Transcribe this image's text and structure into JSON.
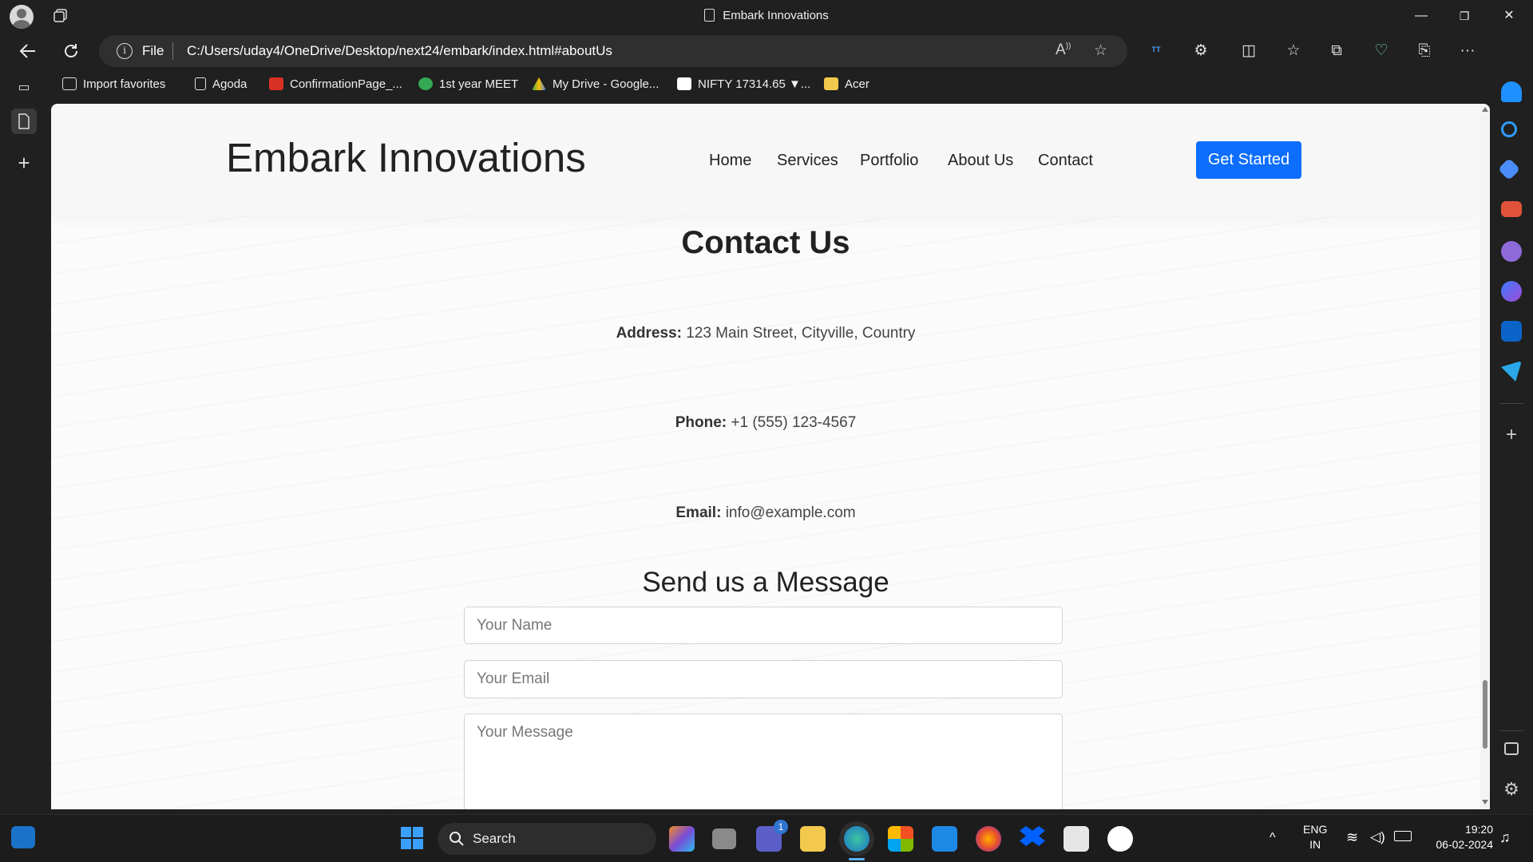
{
  "window": {
    "title": "Embark Innovations",
    "controls": {
      "minimize": "—",
      "maximize": "❐",
      "close": "✕"
    }
  },
  "addressbar": {
    "scheme_label": "File",
    "url": "C:/Users/uday4/OneDrive/Desktop/next24/embark/index.html#aboutUs"
  },
  "favorites": [
    {
      "label": "Import favorites",
      "icon": "import-icon",
      "color": "#dddddd"
    },
    {
      "label": "Agoda",
      "icon": "page-icon",
      "color": "#dddddd"
    },
    {
      "label": "ConfirmationPage_...",
      "icon": "pdf-icon",
      "color": "#d93025"
    },
    {
      "label": "1st year MEET",
      "icon": "meet-icon",
      "color": "#34a853"
    },
    {
      "label": "My Drive - Google...",
      "icon": "drive-icon",
      "color": "#fbbc04"
    },
    {
      "label": "NIFTY 17314.65 ▼...",
      "icon": "tradingview-icon",
      "color": "#ffffff"
    },
    {
      "label": "Acer",
      "icon": "folder-icon",
      "color": "#f2c94c"
    }
  ],
  "site": {
    "brand": "Embark Innovations",
    "nav": [
      "Home",
      "Services",
      "Portfolio",
      "About Us",
      "Contact"
    ],
    "cta": "Get Started",
    "contact_heading": "Contact Us",
    "address_label": "Address:",
    "address_value": "123 Main Street, Cityville, Country",
    "phone_label": "Phone:",
    "phone_value": "+1 (555) 123-4567",
    "email_label": "Email:",
    "email_value": "info@example.com",
    "form_heading": "Send us a Message",
    "name_placeholder": "Your Name",
    "email_placeholder": "Your Email",
    "message_placeholder": "Your Message",
    "accent": "#0d6efd"
  },
  "taskbar": {
    "search_label": "Search",
    "teams_badge": "1",
    "lang_top": "ENG",
    "lang_bottom": "IN",
    "time": "19:20",
    "date": "06-02-2024"
  }
}
